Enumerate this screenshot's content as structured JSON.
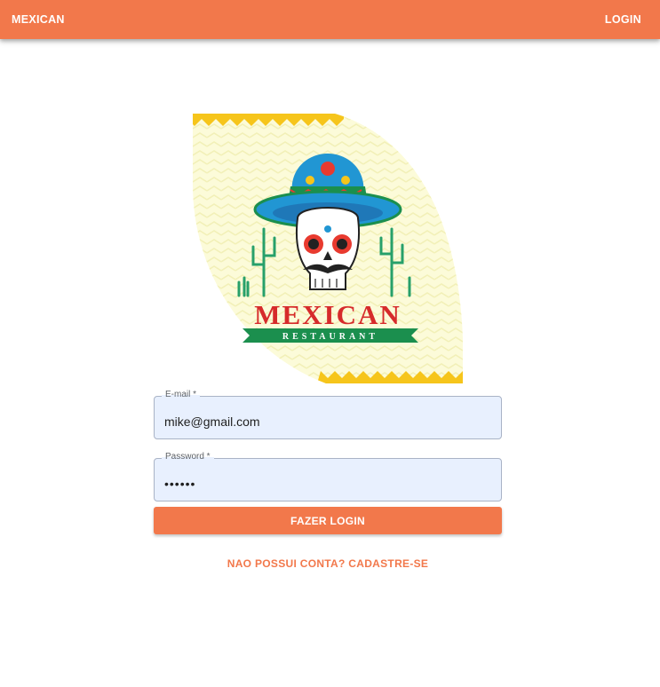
{
  "appbar": {
    "brand": "MEXICAN",
    "login": "LOGIN",
    "color": "#F2784B"
  },
  "logo": {
    "title": "MEXICAN",
    "subtitle": "RESTAURANT"
  },
  "form": {
    "email": {
      "label": "E-mail *",
      "value": "mike@gmail.com"
    },
    "password": {
      "label": "Password *",
      "value": "••••••"
    },
    "submit_label": "FAZER LOGIN"
  },
  "register_link": "NAO POSSUI CONTA? CADASTRE-SE"
}
